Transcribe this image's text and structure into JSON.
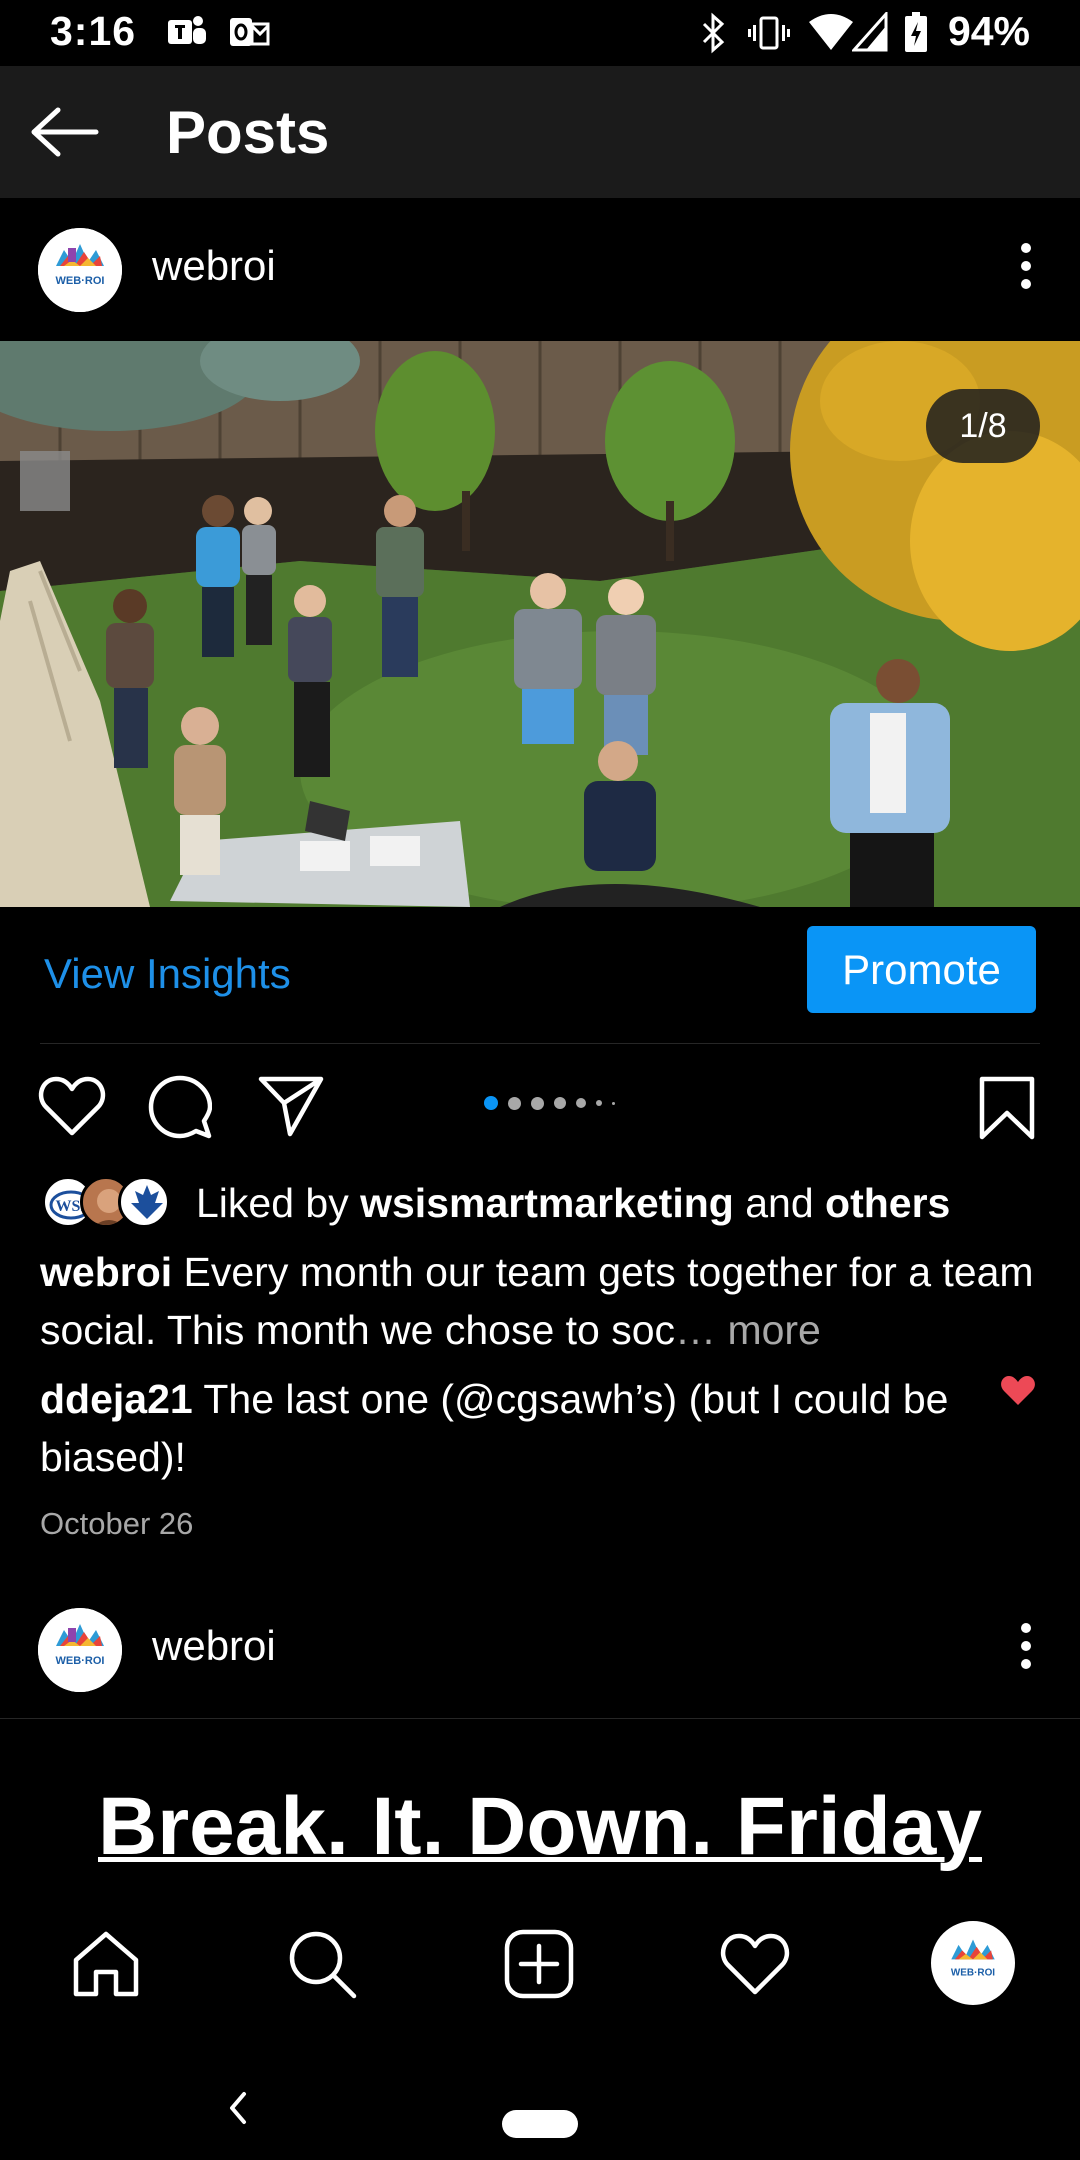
{
  "status_bar": {
    "time": "3:16",
    "battery": "94%",
    "icons": [
      "teams-icon",
      "outlook-icon",
      "bluetooth-icon",
      "vibrate-icon",
      "wifi-icon",
      "signal-icon",
      "battery-charging-icon"
    ]
  },
  "header": {
    "title": "Posts"
  },
  "post1": {
    "username": "webroi",
    "avatar_text": "WEB·ROI",
    "counter": "1/8",
    "view_insights": "View Insights",
    "promote": "Promote",
    "liked_prefix": "Liked by ",
    "liked_user": "wsismartmarketing",
    "liked_and": " and ",
    "liked_others": "others",
    "caption_user": "webroi",
    "caption_text": " Every month our team gets together for a team social. This month we chose to soc",
    "caption_more": "… more",
    "comment_user": "ddeja21",
    "comment_text": " The last one (@cgsawh’s) (but I could be biased)!",
    "date": "October 26"
  },
  "post2": {
    "username": "webroi",
    "headline": "Break. It. Down. Friday"
  },
  "colors": {
    "accent": "#0a95f6",
    "link": "#1e90e8",
    "heart": "#ed4956",
    "bg": "#000000"
  }
}
